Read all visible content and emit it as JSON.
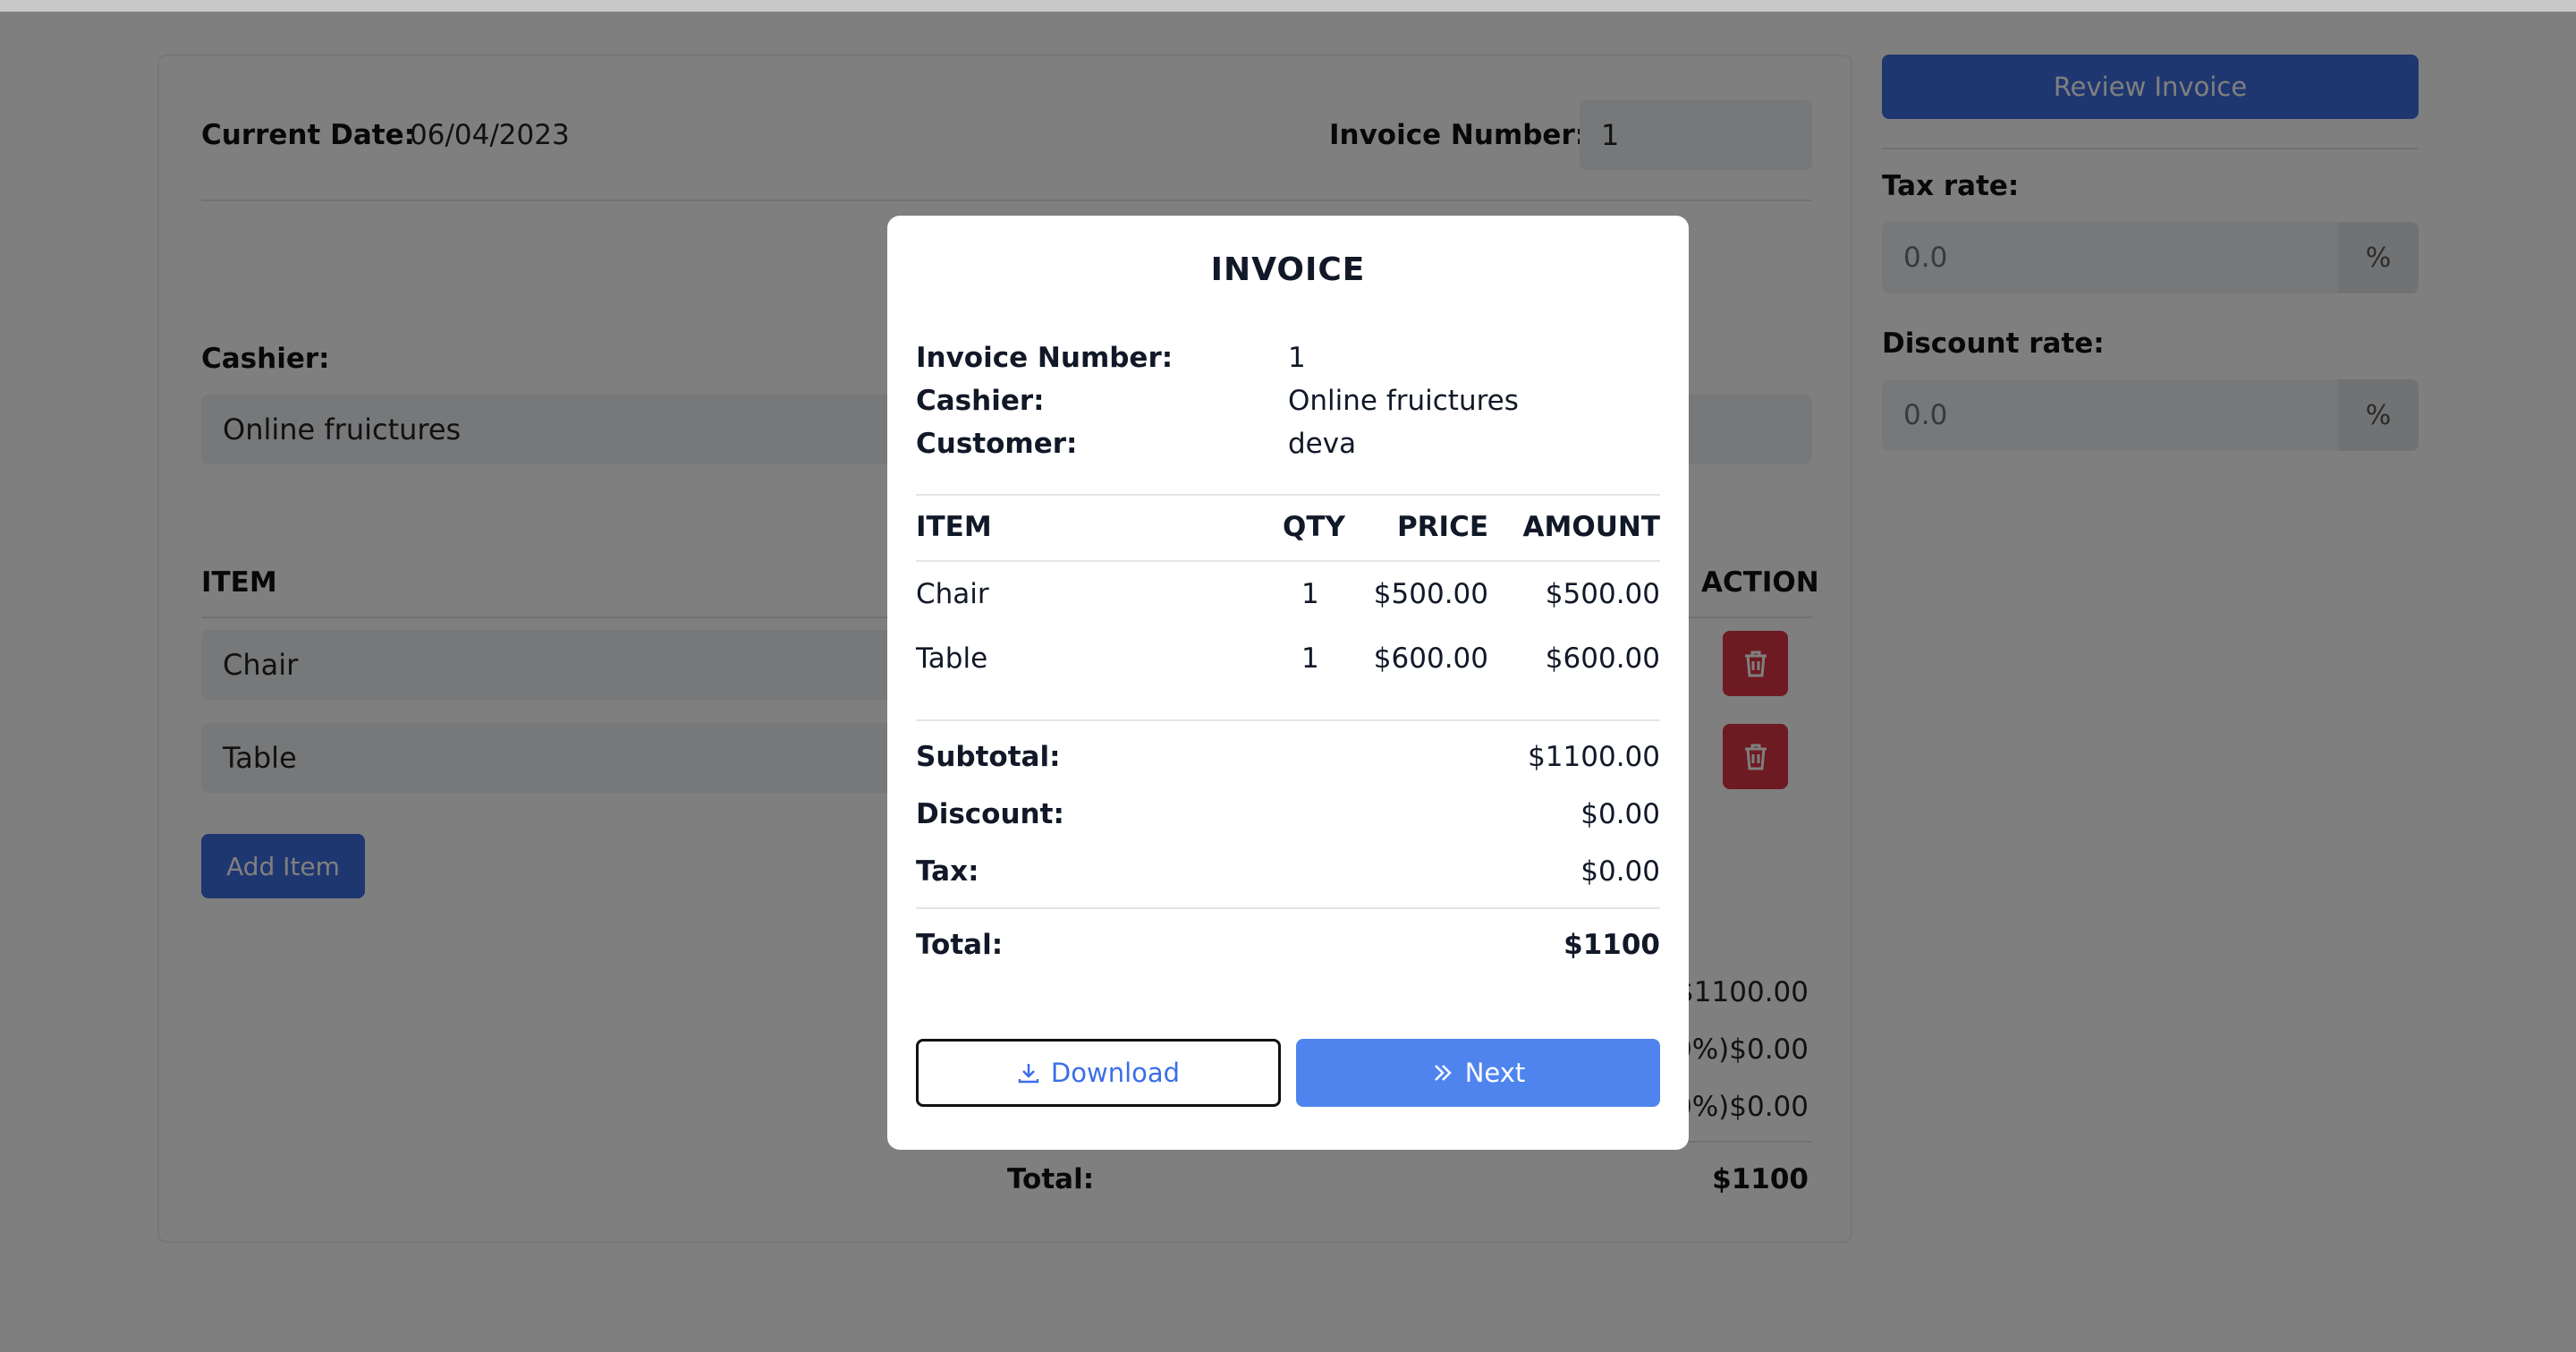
{
  "header": {
    "current_date_label": "Current Date:",
    "current_date_value": "06/04/2023",
    "invoice_number_label": "Invoice Number:",
    "invoice_number_value": "1"
  },
  "cashier": {
    "label": "Cashier:",
    "value": "Online fruictures"
  },
  "items_table": {
    "item_header": "ITEM",
    "action_header": "ACTION",
    "rows": [
      {
        "item": "Chair"
      },
      {
        "item": "Table"
      }
    ],
    "add_item_label": "Add Item"
  },
  "page_totals": {
    "subtotal_value": "$1100.00",
    "discount_value": "0%)$0.00",
    "tax_value": "0%)$0.00",
    "total_label": "Total:",
    "total_value": "$1100"
  },
  "sidebar": {
    "review_button_label": "Review Invoice",
    "tax_rate_label": "Tax rate:",
    "tax_rate_placeholder": "0.0",
    "tax_rate_suffix": "%",
    "discount_rate_label": "Discount rate:",
    "discount_rate_placeholder": "0.0",
    "discount_rate_suffix": "%"
  },
  "modal": {
    "title": "INVOICE",
    "invoice_number_label": "Invoice Number:",
    "invoice_number_value": "1",
    "cashier_label": "Cashier:",
    "cashier_value": "Online fruictures",
    "customer_label": "Customer:",
    "customer_value": "deva",
    "columns": {
      "item": "ITEM",
      "qty": "QTY",
      "price": "PRICE",
      "amount": "AMOUNT"
    },
    "rows": [
      {
        "item": "Chair",
        "qty": "1",
        "price": "$500.00",
        "amount": "$500.00"
      },
      {
        "item": "Table",
        "qty": "1",
        "price": "$600.00",
        "amount": "$600.00"
      }
    ],
    "subtotal_label": "Subtotal:",
    "subtotal_value": "$1100.00",
    "discount_label": "Discount:",
    "discount_value": "$0.00",
    "tax_label": "Tax:",
    "tax_value": "$0.00",
    "total_label": "Total:",
    "total_value": "$1100",
    "download_label": "Download",
    "next_label": "Next"
  },
  "colors": {
    "primary": "#4f84ee",
    "danger": "#dc3545",
    "overlay": "rgba(0,0,0,0.5)"
  }
}
